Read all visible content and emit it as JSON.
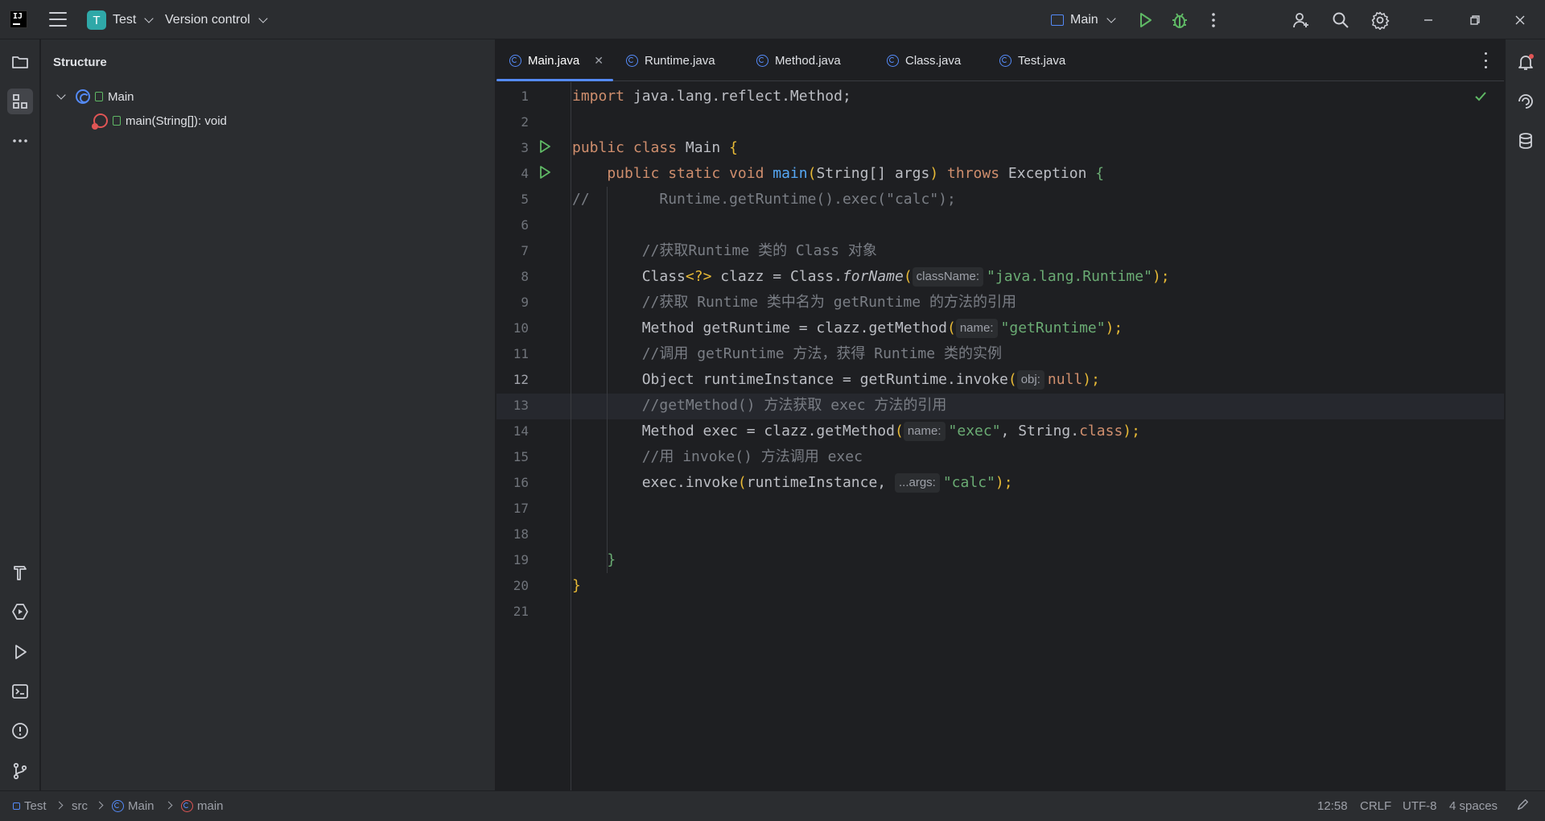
{
  "titlebar": {
    "project_badge": "T",
    "project_name": "Test",
    "vcs_label": "Version control",
    "run_config": "Main",
    "icons": [
      "app-logo-icon",
      "hamburger-menu-icon",
      "run-icon",
      "debug-icon",
      "more-icon",
      "add-user-icon",
      "search-icon",
      "settings-gear-icon",
      "minimize-icon",
      "restore-icon",
      "close-icon"
    ]
  },
  "structure": {
    "title": "Structure",
    "tree": [
      {
        "label": "Main",
        "kind": "class"
      },
      {
        "label": "main(String[]): void",
        "kind": "method"
      }
    ]
  },
  "tabs": [
    {
      "label": "Main.java",
      "active": true
    },
    {
      "label": "Runtime.java",
      "active": false
    },
    {
      "label": "Method.java",
      "active": false
    },
    {
      "label": "Class.java",
      "active": false
    },
    {
      "label": "Test.java",
      "active": false
    }
  ],
  "editor": {
    "current_line": "12",
    "line_numbers": [
      "1",
      "2",
      "3",
      "4",
      "5",
      "6",
      "7",
      "8",
      "9",
      "10",
      "11",
      "12",
      "13",
      "14",
      "15",
      "16",
      "17",
      "18",
      "19",
      "20",
      "21"
    ],
    "hints": {
      "classname": "className:",
      "name1": "name:",
      "obj": "obj:",
      "name2": "name:",
      "args": "...args:"
    },
    "code": {
      "l1a": "import",
      "l1b": " java.lang.reflect.Method;",
      "l3a": "public class",
      "l3b": " Main ",
      "l3c": "{",
      "l4a": "    public static void ",
      "l4b": "main",
      "l4c": "(",
      "l4d": "String[] args",
      "l4e": ")",
      "l4f": " throws ",
      "l4g": "Exception ",
      "l4h": "{",
      "l5": "//        Runtime.getRuntime().exec(\"calc\");",
      "l7": "        //获取Runtime 类的 Class 对象",
      "l8a": "        Class",
      "l8b": "<?>",
      "l8c": " clazz = Class.",
      "l8d": "forName",
      "l8e": "(",
      "l8f": "\"java.lang.Runtime\"",
      "l8g": ");",
      "l9": "        //获取 Runtime 类中名为 getRuntime 的方法的引用",
      "l10a": "        Method getRuntime = clazz.getMethod",
      "l10b": "(",
      "l10c": "\"getRuntime\"",
      "l10d": ");",
      "l11": "        //调用 getRuntime 方法，获得 Runtime 类的实例",
      "l12a": "        Object runtimeInstance = getRuntime.invoke",
      "l12b": "(",
      "l12c": "null",
      "l12d": ");",
      "l13": "        //getMethod() 方法获取 exec 方法的引用",
      "l14a": "        Method exec = clazz.getMethod",
      "l14b": "(",
      "l14c": "\"exec\"",
      "l14d": ", String.",
      "l14e": "class",
      "l14f": ");",
      "l15": "        //用 invoke() 方法调用 exec",
      "l16a": "        exec.invoke",
      "l16b": "(",
      "l16c": "runtimeInstance, ",
      "l16d": "\"calc\"",
      "l16e": ");",
      "l19": "    }",
      "l20": "}"
    }
  },
  "statusbar": {
    "breadcrumbs": [
      "Test",
      "src",
      "Main",
      "main"
    ],
    "position": "12:58",
    "line_sep": "CRLF",
    "encoding": "UTF-8",
    "indent": "4 spaces"
  },
  "colors": {
    "accent": "#548af7",
    "keyword": "#cf8e6d",
    "function": "#56a8f5",
    "string": "#6aab73",
    "comment": "#7a7e85",
    "run_green": "#5fb865"
  }
}
